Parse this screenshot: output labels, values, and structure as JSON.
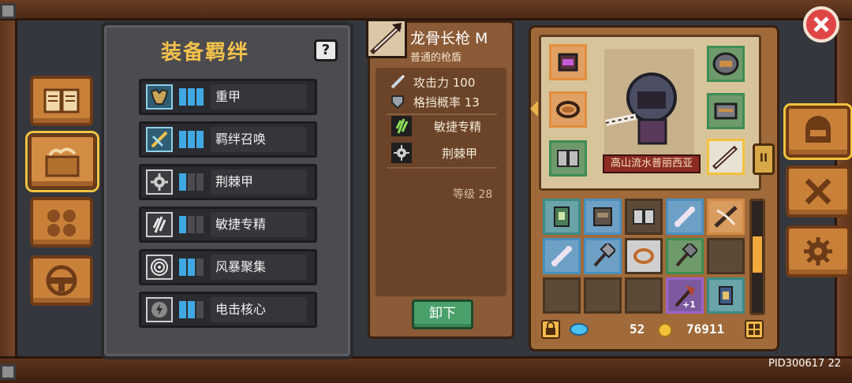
{
  "bonds": {
    "title": "装备羁绊",
    "help_label": "?",
    "items": [
      {
        "label": "重甲",
        "icon": "heavy-armor-icon",
        "active": true
      },
      {
        "label": "羁绊召唤",
        "icon": "summon-bond-icon",
        "active": true
      },
      {
        "label": "荆棘甲",
        "icon": "thorn-armor-icon",
        "active": false
      },
      {
        "label": "敏捷专精",
        "icon": "agility-icon",
        "active": false
      },
      {
        "label": "风暴聚集",
        "icon": "storm-icon",
        "active": false
      },
      {
        "label": "电击核心",
        "icon": "shock-core-icon",
        "active": false
      }
    ]
  },
  "detail": {
    "name": "龙骨长枪 M",
    "subtitle": "普通的枪盾",
    "attack_label": "攻击力 100",
    "block_label": "格挡概率 13",
    "perk1": "敏捷专精",
    "perk2": "荆棘甲",
    "level_label": "等级 28",
    "unequip_label": "卸下"
  },
  "character": {
    "hero_name": "高山流水普丽西亚",
    "tier_label": "II"
  },
  "currency": {
    "gems": "52",
    "gold": "76911"
  },
  "pid_label": "PID300617  22",
  "colors": {
    "accent_gold": "#f2c14a",
    "bar_active": "#40a9e4",
    "close_red": "#e04545",
    "button_green": "#4aa06a"
  }
}
